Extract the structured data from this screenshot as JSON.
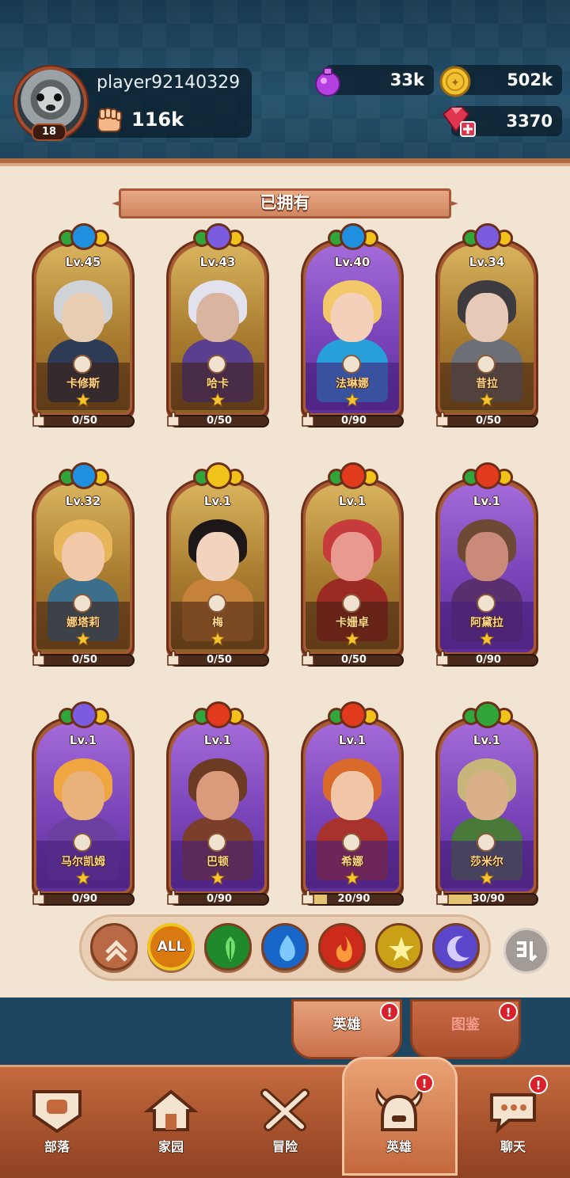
{
  "player": {
    "name": "player92140329",
    "level": "18",
    "power": "116k"
  },
  "resources": {
    "potion": "33k",
    "coins": "502k",
    "gems": "3370"
  },
  "section_title": "已拥有",
  "heroes": [
    {
      "name": "卡修斯",
      "level": "Lv.45",
      "fragments": "0/50",
      "fragment_progress": 0,
      "element": "water",
      "rarity": "gold",
      "stars": 1
    },
    {
      "name": "哈卡",
      "level": "Lv.43",
      "fragments": "0/50",
      "fragment_progress": 0,
      "element": "moon",
      "rarity": "gold",
      "stars": 1
    },
    {
      "name": "法琳娜",
      "level": "Lv.40",
      "fragments": "0/90",
      "fragment_progress": 0,
      "element": "water",
      "rarity": "purple",
      "stars": 1
    },
    {
      "name": "昔拉",
      "level": "Lv.34",
      "fragments": "0/50",
      "fragment_progress": 0,
      "element": "moon",
      "rarity": "gold",
      "stars": 1
    },
    {
      "name": "娜塔莉",
      "level": "Lv.32",
      "fragments": "0/50",
      "fragment_progress": 0,
      "element": "water",
      "rarity": "gold",
      "stars": 1
    },
    {
      "name": "梅",
      "level": "Lv.1",
      "fragments": "0/50",
      "fragment_progress": 0,
      "element": "light",
      "rarity": "gold",
      "stars": 1
    },
    {
      "name": "卡姗卓",
      "level": "Lv.1",
      "fragments": "0/50",
      "fragment_progress": 0,
      "element": "fire",
      "rarity": "gold",
      "stars": 1
    },
    {
      "name": "阿黛拉",
      "level": "Lv.1",
      "fragments": "0/90",
      "fragment_progress": 0,
      "element": "fire",
      "rarity": "purple",
      "stars": 1
    },
    {
      "name": "马尔凯姆",
      "level": "Lv.1",
      "fragments": "0/90",
      "fragment_progress": 0,
      "element": "moon",
      "rarity": "purple",
      "stars": 1
    },
    {
      "name": "巴顿",
      "level": "Lv.1",
      "fragments": "0/90",
      "fragment_progress": 0,
      "element": "fire",
      "rarity": "purple",
      "stars": 1
    },
    {
      "name": "希娜",
      "level": "Lv.1",
      "fragments": "20/90",
      "fragment_progress": 0.22,
      "element": "fire",
      "rarity": "purple",
      "stars": 1
    },
    {
      "name": "莎米尔",
      "level": "Lv.1",
      "fragments": "30/90",
      "fragment_progress": 0.33,
      "element": "nature",
      "rarity": "purple",
      "stars": 1
    }
  ],
  "filters": [
    {
      "name": "rank-sort",
      "label": ""
    },
    {
      "name": "all",
      "label": "ALL"
    },
    {
      "name": "nature",
      "label": ""
    },
    {
      "name": "water",
      "label": ""
    },
    {
      "name": "fire",
      "label": ""
    },
    {
      "name": "light",
      "label": ""
    },
    {
      "name": "moon",
      "label": ""
    }
  ],
  "element_colors": {
    "water": "#1f8fe0",
    "moon": "#7b5ce0",
    "fire": "#e23a1c",
    "light": "#f0c21a",
    "nature": "#2fa53a"
  },
  "subtabs": {
    "heroes": "英雄",
    "codex": "图鉴",
    "badge": "!"
  },
  "nav": [
    {
      "name": "tribe",
      "label": "部落"
    },
    {
      "name": "home",
      "label": "家园"
    },
    {
      "name": "adventure",
      "label": "冒险"
    },
    {
      "name": "heroes",
      "label": "英雄"
    },
    {
      "name": "chat",
      "label": "聊天"
    }
  ],
  "nav_badge": "!"
}
